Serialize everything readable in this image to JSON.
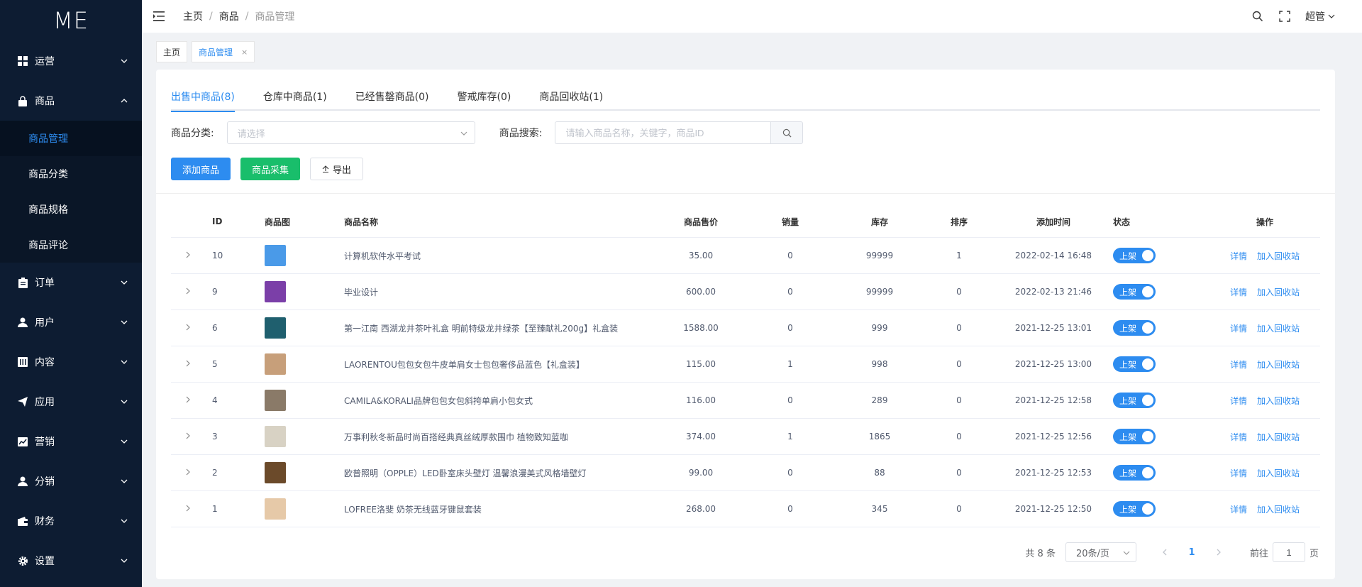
{
  "logo": "ME",
  "sidebar": {
    "items": [
      {
        "label": "运营",
        "icon": "dashboard-icon",
        "expanded": false
      },
      {
        "label": "商品",
        "icon": "lock-bag-icon",
        "expanded": true,
        "children": [
          {
            "label": "商品管理",
            "active": true
          },
          {
            "label": "商品分类"
          },
          {
            "label": "商品规格"
          },
          {
            "label": "商品评论"
          }
        ]
      },
      {
        "label": "订单",
        "icon": "clipboard-icon",
        "expanded": false
      },
      {
        "label": "用户",
        "icon": "user-icon",
        "expanded": false
      },
      {
        "label": "内容",
        "icon": "book-icon",
        "expanded": false
      },
      {
        "label": "应用",
        "icon": "send-icon",
        "expanded": false
      },
      {
        "label": "营销",
        "icon": "chart-icon",
        "expanded": false
      },
      {
        "label": "分销",
        "icon": "user-icon",
        "expanded": false
      },
      {
        "label": "财务",
        "icon": "wallet-icon",
        "expanded": false
      },
      {
        "label": "设置",
        "icon": "gear-icon",
        "expanded": false
      }
    ]
  },
  "header": {
    "breadcrumb": [
      "主页",
      "商品",
      "商品管理"
    ],
    "user": "超管"
  },
  "tagbar": {
    "tags": [
      {
        "label": "主页",
        "active": false
      },
      {
        "label": "商品管理",
        "active": true,
        "close": "×"
      }
    ]
  },
  "tabs": [
    "出售中商品(8)",
    "仓库中商品(1)",
    "已经售罄商品(0)",
    "警戒库存(0)",
    "商品回收站(1)"
  ],
  "filters": {
    "category_label": "商品分类:",
    "category_placeholder": "请选择",
    "search_label": "商品搜索:",
    "search_placeholder": "请输入商品名称，关键字，商品ID"
  },
  "actions": {
    "add": "添加商品",
    "collect": "商品采集",
    "export": "导出"
  },
  "table": {
    "columns": [
      "ID",
      "商品图",
      "商品名称",
      "商品售价",
      "销量",
      "库存",
      "排序",
      "添加时间",
      "状态",
      "操作"
    ],
    "status_on": "上架",
    "op_detail": "详情",
    "op_recycle": "加入回收站",
    "rows": [
      {
        "id": "10",
        "name": "计算机软件水平考试",
        "price": "35.00",
        "sales": "0",
        "stock": "99999",
        "sort": "1",
        "time": "2022-02-14 16:48",
        "thumb": "#4a9ae8"
      },
      {
        "id": "9",
        "name": "毕业设计",
        "price": "600.00",
        "sales": "0",
        "stock": "99999",
        "sort": "0",
        "time": "2022-02-13 21:46",
        "thumb": "#7b3fa8"
      },
      {
        "id": "6",
        "name": "第一江南 西湖龙井茶叶礼盒 明前特级龙井绿茶【至臻献礼200g】礼盒装",
        "price": "1588.00",
        "sales": "0",
        "stock": "999",
        "sort": "0",
        "time": "2021-12-25 13:01",
        "thumb": "#1f5f6e"
      },
      {
        "id": "5",
        "name": "LAORENTOU包包女包牛皮单肩女士包包奢侈品蓝色【礼盒装】",
        "price": "115.00",
        "sales": "1",
        "stock": "998",
        "sort": "0",
        "time": "2021-12-25 13:00",
        "thumb": "#c79f7a"
      },
      {
        "id": "4",
        "name": "CAMILA&KORALI品牌包包女包斜挎单肩小包女式",
        "price": "116.00",
        "sales": "0",
        "stock": "289",
        "sort": "0",
        "time": "2021-12-25 12:58",
        "thumb": "#8a7a68"
      },
      {
        "id": "3",
        "name": "万事利秋冬新品时尚百搭经典真丝绒厚款围巾 植物致知蓝咖",
        "price": "374.00",
        "sales": "1",
        "stock": "1865",
        "sort": "0",
        "time": "2021-12-25 12:56",
        "thumb": "#d8d2c4"
      },
      {
        "id": "2",
        "name": "欧普照明（OPPLE）LED卧室床头壁灯 温馨浪漫美式风格墙壁灯",
        "price": "99.00",
        "sales": "0",
        "stock": "88",
        "sort": "0",
        "time": "2021-12-25 12:53",
        "thumb": "#6b4a2a"
      },
      {
        "id": "1",
        "name": "LOFREE洛斐 奶茶无线蓝牙键鼠套装",
        "price": "268.00",
        "sales": "0",
        "stock": "345",
        "sort": "0",
        "time": "2021-12-25 12:50",
        "thumb": "#e6c9a8"
      }
    ]
  },
  "pagination": {
    "total": "共 8 条",
    "page_size": "20条/页",
    "current": "1",
    "goto_prefix": "前往",
    "goto_value": "1",
    "goto_suffix": "页"
  }
}
